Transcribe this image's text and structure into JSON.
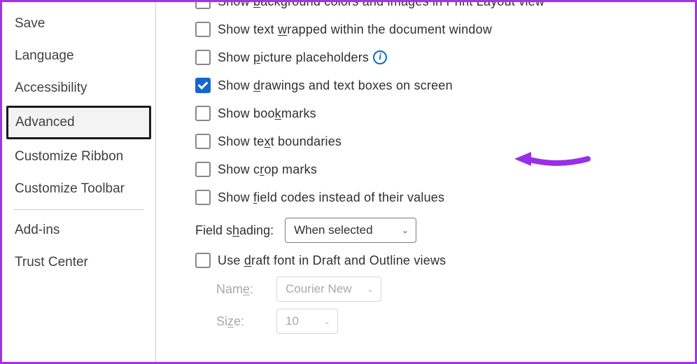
{
  "sidebar": {
    "items": [
      {
        "label": "Save"
      },
      {
        "label": "Language"
      },
      {
        "label": "Accessibility"
      },
      {
        "label": "Advanced",
        "selected": true
      },
      {
        "label": "Customize Ribbon"
      },
      {
        "label": "Customize Toolbar"
      }
    ],
    "items_after": [
      {
        "label": "Add-ins"
      },
      {
        "label": "Trust Center"
      }
    ]
  },
  "options": {
    "bg_colors": {
      "label_pre": "Show ",
      "key": "b",
      "label_post": "ackground colors and images in Print Layout view",
      "checked": false
    },
    "wrapped": {
      "label_pre": "Show text ",
      "key": "w",
      "label_post": "rapped within the document window",
      "checked": false
    },
    "picture_ph": {
      "label_pre": "Show ",
      "key": "p",
      "label_post": "icture placeholders",
      "checked": false,
      "info": true
    },
    "drawings": {
      "label_pre": "Show ",
      "key": "d",
      "label_post": "rawings and text boxes on screen",
      "checked": true
    },
    "bookmarks": {
      "label_pre": "Show boo",
      "key": "k",
      "label_post": "marks",
      "checked": false
    },
    "text_bound": {
      "label_pre": "Show te",
      "key": "x",
      "label_post": "t boundaries",
      "checked": false
    },
    "crop_marks": {
      "label_pre": "Show c",
      "key": "r",
      "label_post": "op marks",
      "checked": false
    },
    "field_codes": {
      "label_pre": "Show ",
      "key": "f",
      "label_post": "ield codes instead of their values",
      "checked": false
    },
    "draft_font": {
      "label_pre": "Use ",
      "key": "d",
      "label_post": "raft font in Draft and Outline views",
      "checked": false
    }
  },
  "field_shading": {
    "label_pre": "Field s",
    "key": "h",
    "label_post": "ading:",
    "value": "When selected"
  },
  "draft_name": {
    "label_pre": "Nam",
    "key": "e",
    "label_post": ":",
    "value": "Courier New"
  },
  "draft_size": {
    "label_pre": "Si",
    "key": "z",
    "label_post": "e:",
    "value": "10"
  }
}
